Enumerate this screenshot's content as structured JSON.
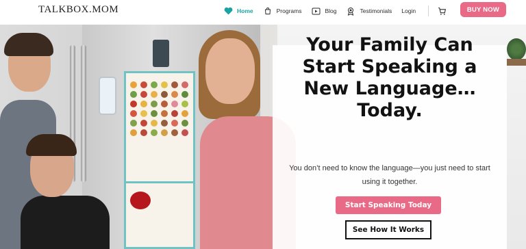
{
  "brand": {
    "logo_text": "TALKBOX.MOM"
  },
  "nav": {
    "items": [
      {
        "label": "Home",
        "icon": "heart-icon",
        "active": true
      },
      {
        "label": "Programs",
        "icon": "bag-icon",
        "active": false
      },
      {
        "label": "Blog",
        "icon": "play-icon",
        "active": false
      },
      {
        "label": "Testimonials",
        "icon": "badge-icon",
        "active": false
      },
      {
        "label": "Login",
        "icon": "",
        "active": false
      }
    ],
    "cart_icon": "cart-icon",
    "buy_label": "BUY NOW"
  },
  "hero": {
    "title_lines": [
      "Your Family Can",
      "Start Speaking a",
      "New Language…",
      "Today."
    ],
    "subtitle_lines": [
      "You don’t need to know the language—you just need to start",
      "using it together."
    ],
    "primary_cta": "Start Speaking Today",
    "secondary_cta": "See How It Works"
  },
  "colors": {
    "accent": "#e86a86",
    "nav_active": "#1aa3a3",
    "text": "#121212"
  }
}
